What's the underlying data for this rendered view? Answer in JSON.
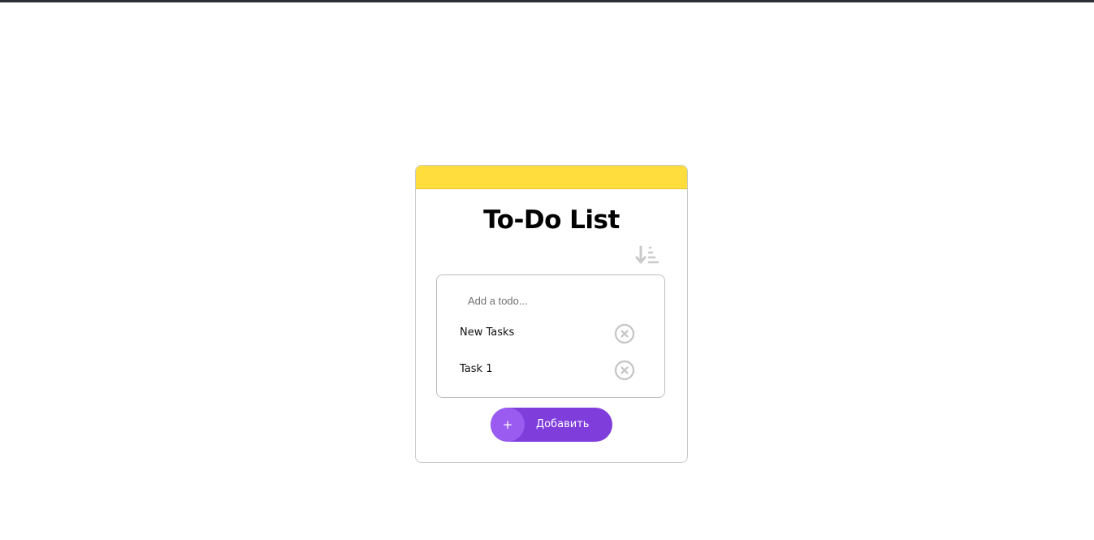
{
  "app": {
    "title": "To-Do List",
    "header_color": "#ffdd3c",
    "accent_color": "#7f3ddc"
  },
  "toolbar": {
    "sort_icon": "sort-descending-icon"
  },
  "input": {
    "value": "",
    "placeholder": "Add a todo..."
  },
  "todos": [
    {
      "text": "New Tasks",
      "remove_icon": "close-circle-icon"
    },
    {
      "text": "Task 1",
      "remove_icon": "close-circle-icon"
    }
  ],
  "add_button": {
    "icon": "+",
    "label": "Добавить"
  }
}
